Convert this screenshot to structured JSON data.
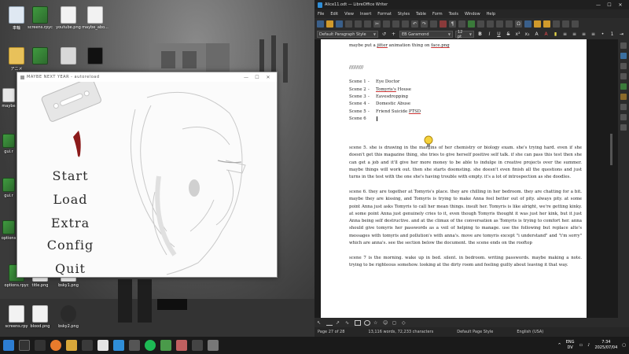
{
  "desktop": {
    "icons": [
      {
        "label": "車輪",
        "kind": "recycle"
      },
      {
        "label": "screens.rpyc",
        "kind": "img"
      },
      {
        "label": "youtube.png",
        "kind": "file"
      },
      {
        "label": "maybe_abo...",
        "kind": "file"
      },
      {
        "label": "アニメ",
        "kind": "folder"
      },
      {
        "label": "",
        "kind": "img"
      },
      {
        "label": "",
        "kind": "file"
      },
      {
        "label": "",
        "kind": "dark"
      },
      {
        "label": "maybe",
        "kind": "blade"
      },
      {
        "label": "gui.r",
        "kind": "img"
      },
      {
        "label": "gui.r",
        "kind": "img"
      },
      {
        "label": "options",
        "kind": "img"
      },
      {
        "label": "options.rpyc",
        "kind": "img"
      },
      {
        "label": "title.png",
        "kind": "file"
      },
      {
        "label": "bsky1.png",
        "kind": "file"
      },
      {
        "label": "screens.rpy",
        "kind": "file"
      },
      {
        "label": "blood.png",
        "kind": "file"
      },
      {
        "label": "bsky2.png",
        "kind": "file"
      }
    ]
  },
  "game": {
    "title": "MAYBE NEXT YEAR - autoreload",
    "menu": [
      "Start",
      "Load",
      "Extra",
      "Config",
      "Quit"
    ]
  },
  "writer": {
    "title": "Alice11.odt — LibreOffice Writer",
    "menu": [
      "File",
      "Edit",
      "View",
      "Insert",
      "Format",
      "Styles",
      "Table",
      "Form",
      "Tools",
      "Window",
      "Help"
    ],
    "para_style": "Default Paragraph Style",
    "font_name": "EB Garamond",
    "font_size": "12 pt",
    "doc": {
      "line0_pre": "maybe put a ",
      "line0_u1": "jitter",
      "line0_mid": " animation thing on ",
      "line0_u2": "face.png",
      "slashes": "//////////",
      "scenes": [
        {
          "num": "Scene 1",
          "dash": "-",
          "pre": "",
          "u": "",
          "post": "Eye Doctor"
        },
        {
          "num": "Scene 2",
          "dash": "-",
          "pre": "",
          "u": "Tomyris's",
          "post": " House"
        },
        {
          "num": "Scene 3",
          "dash": "-",
          "pre": "",
          "u": "",
          "post": "Eavesdropping"
        },
        {
          "num": "Scene 4",
          "dash": "-",
          "pre": "",
          "u": "",
          "post": "Domestic Abuse"
        },
        {
          "num": "Scene 5",
          "dash": "-",
          "pre": "Friend Suicide ",
          "u": "PTSD",
          "post": ""
        },
        {
          "num": "Scene 6",
          "dash": "",
          "pre": "",
          "u": "",
          "post": ""
        }
      ],
      "p1": "scene 5. she is drawing in the margins of her chemistry or biology exam. she's trying hard. even if she doesn't get this magazine thing, she tries to give herself positive self talk. if she can pass this test then she can get a job and it'll give her more money to be able to indulge in creative projects over the summer. maybe things will work out. then she starts doomsting. she doesn't even finish all the questions and just turns in the test with the one she's having trouble with empty. it's a lot of introspection as she doodles.",
      "p2": "scene 6. they are together at Tomyris's place. they are chilling in her bedroom. they are chatting for a bit. maybe they are kissing, and Tomyris is trying to make Anna feel better out of pity. always pity. at some point Anna just asks Tomyris to call her mean things. insult her. Tomyris is like alright, we're getting kinky. at some point Anna just genuinely cries to it, even though Tomyris thought it was just her kink, but it just Anna being self destructive. and at the climax of the conversation as Tomyris is trying to comfort her. anna should give tomyris her passwords as a veil of helping to manage. use the following but replace alte's messages with tomyris and pollution's with anna's. move are tomyris except \"i understand\" and \"i'm sorry\" which are anna's. see the section below the document. the scene ends on the rooftop",
      "p3": "scene 7 is the morning. wake up in bed. silent. in bedroom. writing passwords. maybe making a note. trying to be righteous somehow. looking at the dirty room and feeling guilty about leaving it that way."
    },
    "status": {
      "page": "Page 27 of 28",
      "words": "13,116 words, 72,233 characters",
      "style": "Default Page Style",
      "lang": "English (USA)"
    }
  },
  "taskbar": {
    "lang1": "ENG",
    "lang2": "DV",
    "time": "7:34",
    "date": "2025/07/04"
  },
  "colors": {
    "accent": "#2f8ed8",
    "blood": "#8b1a1a"
  }
}
